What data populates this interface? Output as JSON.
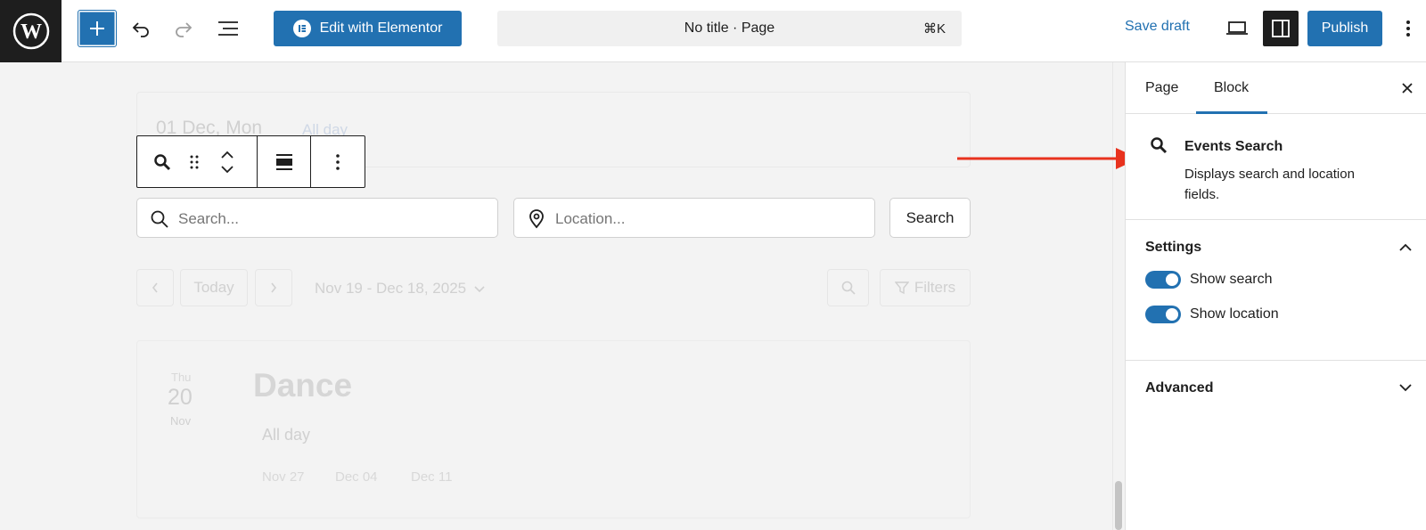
{
  "topbar": {
    "add_block_icon": "plus-icon",
    "undo_icon": "undo-icon",
    "redo_icon": "redo-icon",
    "list_view_icon": "list-view-icon",
    "elementor_label": "Edit with Elementor",
    "document_title": "No title · Page",
    "command_shortcut": "⌘K",
    "save_draft_label": "Save draft",
    "publish_label": "Publish"
  },
  "block_toolbar": {
    "icons": [
      "search-icon",
      "drag-handle-icon",
      "move-up-icon",
      "move-down-icon",
      "align-icon",
      "more-options-icon"
    ]
  },
  "canvas": {
    "faded_date": "01 Dec, Mon",
    "faded_allday": "All day",
    "search_placeholder": "Search...",
    "location_placeholder": "Location...",
    "search_button": "Search",
    "today_label": "Today",
    "date_range": "Nov 19 - Dec 18, 2025",
    "filters_label": "Filters",
    "event": {
      "weekday": "Thu",
      "day": "20",
      "month": "Nov",
      "title": "Dance",
      "time": "All day",
      "occurrences": [
        "Nov 27",
        "Dec 04",
        "Dec 11"
      ]
    }
  },
  "sidebar": {
    "tabs": [
      "Page",
      "Block"
    ],
    "active_tab": "Block",
    "block": {
      "name": "Events Search",
      "description": "Displays search and location fields."
    },
    "settings": {
      "title": "Settings",
      "toggles": [
        {
          "label": "Show search",
          "on": true
        },
        {
          "label": "Show location",
          "on": true
        }
      ]
    },
    "advanced": {
      "title": "Advanced"
    }
  },
  "colors": {
    "accent": "#2271b1",
    "dark": "#1e1e1e",
    "annotation_arrow": "#e8321e"
  }
}
